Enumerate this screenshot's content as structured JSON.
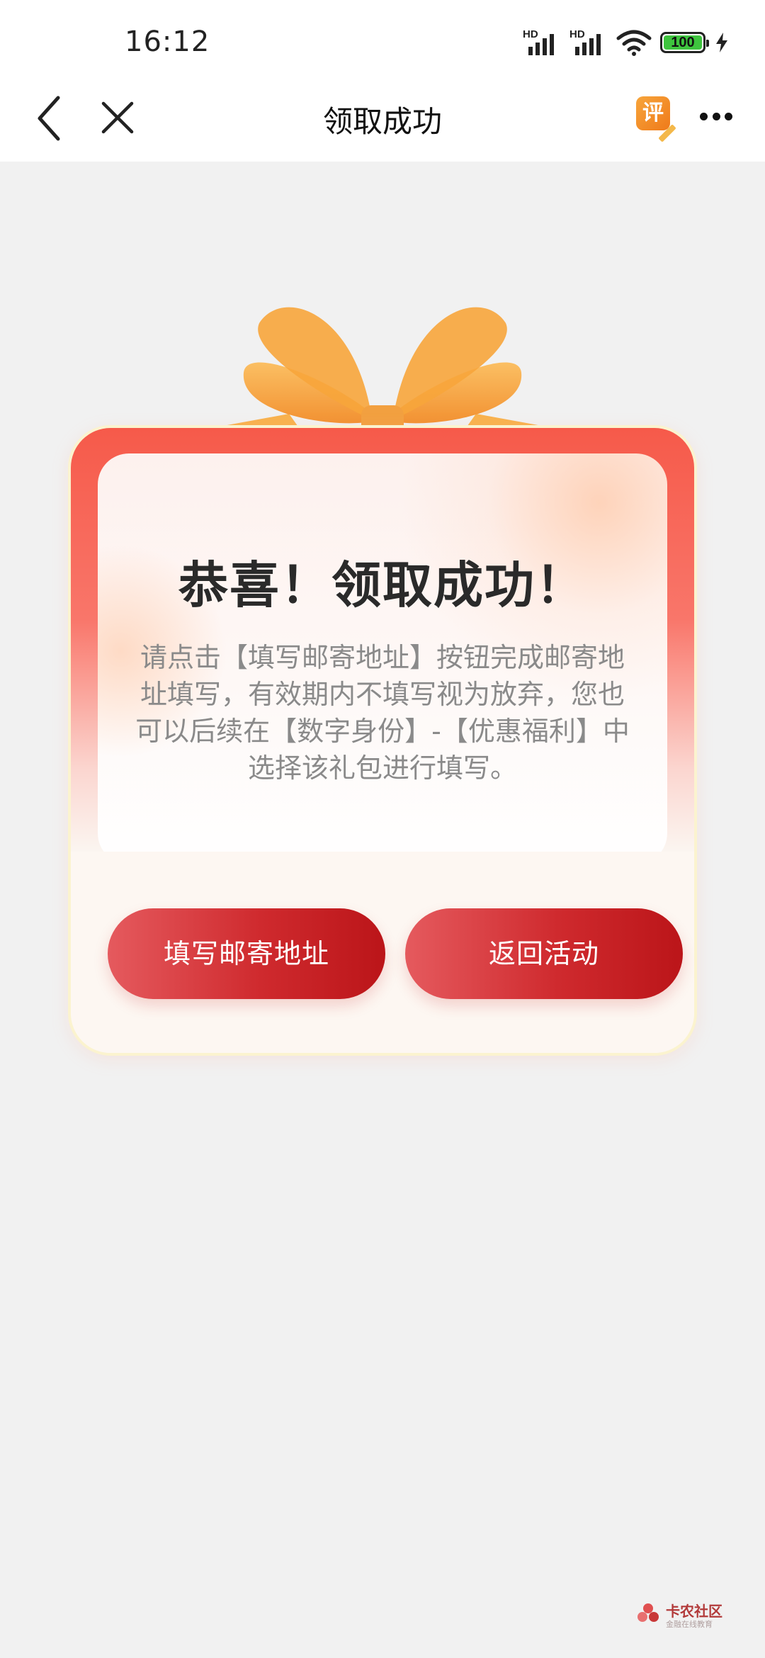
{
  "status_bar": {
    "time": "16:12",
    "signal_1_label": "HD",
    "signal_2_label": "HD",
    "battery_level": "100",
    "icons": [
      "signal-icon",
      "signal-icon",
      "wifi-icon",
      "battery-icon",
      "charging-icon"
    ]
  },
  "nav": {
    "title": "领取成功",
    "rate_label": "评",
    "icons": [
      "back-icon",
      "close-icon",
      "rate-icon",
      "more-icon"
    ]
  },
  "card": {
    "headline": "恭喜！领取成功！",
    "description": "请点击【填写邮寄地址】按钮完成邮寄地址填写，有效期内不填写视为放弃，您也可以后续在【数字身份】-【优惠福利】中选择该礼包进行填写。",
    "button_address": "填写邮寄地址",
    "button_return": "返回活动"
  },
  "watermark": {
    "name": "卡农社区",
    "sub": "金融在线教育"
  },
  "colors": {
    "accent_red": "#cf2a2e",
    "card_red": "#f65a4a",
    "ribbon_orange": "#f7a53b",
    "background": "#f1f1f1"
  }
}
